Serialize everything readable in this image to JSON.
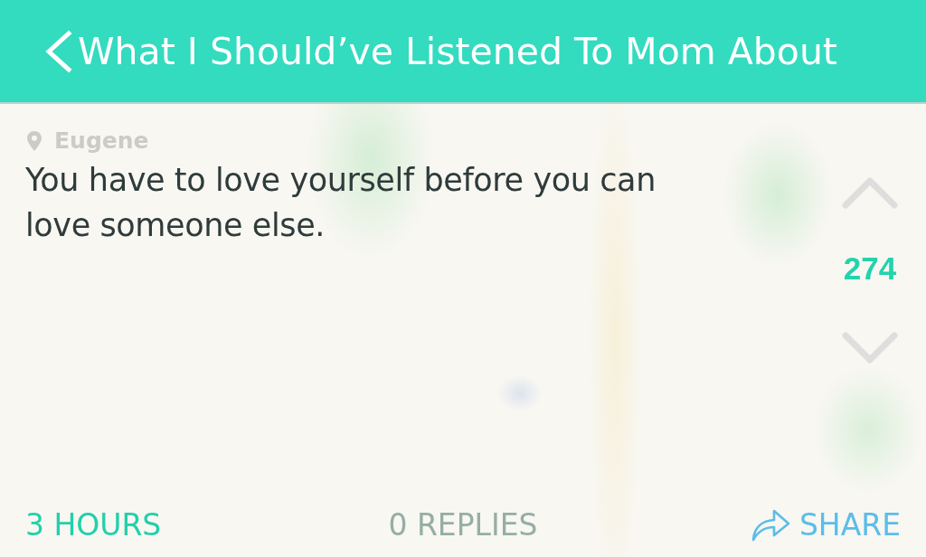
{
  "header": {
    "title": "What I Should’ve Listened To Mom About"
  },
  "post": {
    "location": "Eugene",
    "message": "You have to love yourself before you can love someone else.",
    "votes": {
      "count": "274"
    }
  },
  "footer": {
    "time": "3 HOURS",
    "replies": "0 REPLIES",
    "share": "SHARE"
  }
}
